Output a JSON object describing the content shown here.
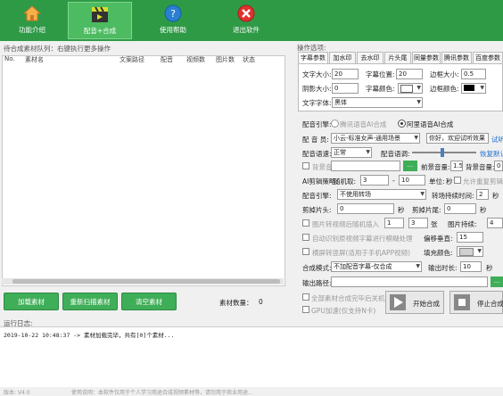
{
  "toolbar": {
    "items": [
      {
        "label": "功能介绍",
        "icon": "home-icon"
      },
      {
        "label": "配音+合成",
        "icon": "film-clapper-icon"
      },
      {
        "label": "使用帮助",
        "icon": "help-icon"
      },
      {
        "label": "退出软件",
        "icon": "close-icon"
      }
    ]
  },
  "left": {
    "title": "待合成素材队列：右键执行更多操作",
    "columns": [
      "No.",
      "素材名",
      "文案路径",
      "配音",
      "视频数",
      "图片数",
      "状态"
    ],
    "buttons": {
      "add": "加载素材",
      "rescan": "重新扫描素材",
      "clear": "清空素材"
    },
    "count_label": "素材数量：",
    "count_value": "0"
  },
  "right": {
    "title": "操作选项:",
    "tabs": [
      "字幕参数",
      "加水印",
      "去水印",
      "片头尾",
      "同量参数",
      "腾讯参数",
      "百度参数"
    ],
    "subtitle": {
      "font_size_label": "文字大小:",
      "font_size": "20",
      "pos_label": "字幕位置:",
      "pos": "20",
      "border_label": "边框大小:",
      "border": "0.5",
      "shadow_label": "阴影大小:",
      "shadow": "0",
      "color_label": "字幕颜色:",
      "border_color_label": "边框颜色:",
      "font_label": "文字字体:",
      "font": "黑体"
    },
    "engine": {
      "label": "配音引擎:",
      "opt1": "腾讯语音AI合成",
      "opt2": "阿里语音AI合成"
    },
    "voice": {
      "label": "配 音 员:",
      "value": "小云-标准女声-通用场景",
      "sample": "你好，欢迎试听效果",
      "try": "试听"
    },
    "speed": {
      "label": "配音语速:",
      "value": "正常",
      "tone_label": "配音语调:",
      "restore": "恢复默认"
    },
    "bgm": {
      "label": "背景音",
      "front_label": "前景音量:",
      "front": "1.5",
      "back_label": "背景音量:",
      "back": "0"
    },
    "clip": {
      "label": "AI剪辑策略:",
      "rand_label": "随机取:",
      "from": "3",
      "dash": "-",
      "to": "10",
      "unit": "单位:",
      "sec": "秒",
      "repeat": "允许重复剪辑"
    },
    "trans": {
      "label": "配音引擎:",
      "value": "不使用转场",
      "dur_label": "转场持续时间:",
      "dur": "2",
      "sec": "秒"
    },
    "cut": {
      "head_label": "剪掉片头:",
      "head": "0",
      "sec1": "秒",
      "tail_label": "剪掉片尾:",
      "tail": "0",
      "sec2": "秒"
    },
    "imgins": {
      "label": "图片转视频后随机插入",
      "from": "1",
      "to": "3",
      "unit": "张",
      "dur_label": "图片持续:",
      "dur": "4"
    },
    "auto_sub": "自动识别原视频字幕进行模糊处理",
    "offset_label": "偏移垂直:",
    "offset": "15",
    "hscreen": "横屏转竖屏(适用于手机APP视频)",
    "fill_label": "填充颜色:",
    "mode": {
      "label": "合成模式:",
      "value": "不加配音字幕-仅合成",
      "dur_label": "输出时长:",
      "dur": "10",
      "sec": "秒"
    },
    "out_label": "输出路径:",
    "opt_after": "全部素材合成完毕后关机",
    "gpu": "GPU加速(仅支持N卡)",
    "start_btn": "开始合成",
    "stop_btn": "停止合成"
  },
  "log": {
    "title": "运行日志:",
    "line": "2019-10-22 10:48:37 -> 素材加载完毕，共有[0]个素材..."
  },
  "status": {
    "version": "版本: V4.0",
    "notice": "使用说明：本软件仅用于个人学习用途合成视频素材等，请勿用于商业用途..."
  },
  "colors": {
    "brand": "#2e9a46",
    "button": "#3fae58"
  }
}
